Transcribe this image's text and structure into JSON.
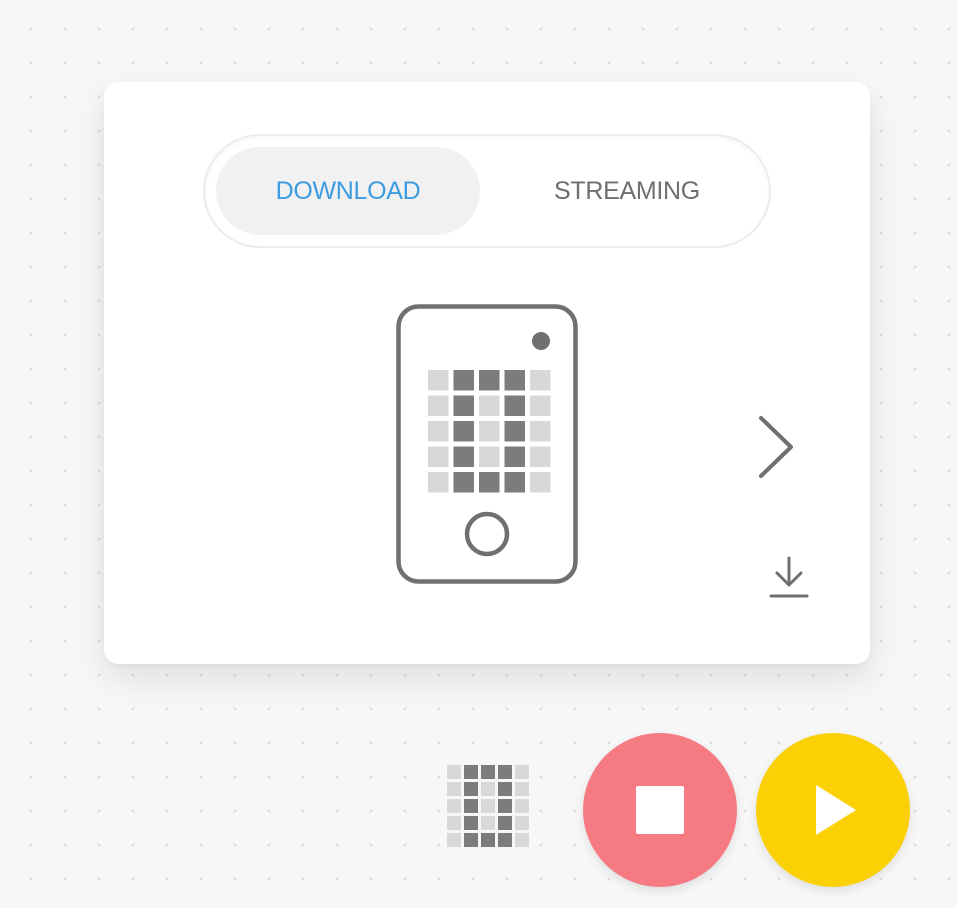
{
  "tabs": {
    "download_label": "DOWNLOAD",
    "streaming_label": "STREAMING",
    "active": "download"
  },
  "icons": {
    "device": "phone-led-matrix-icon",
    "next": "chevron-right-icon",
    "download": "download-icon",
    "preview": "led-matrix-icon",
    "stop": "stop-icon",
    "play": "play-icon"
  },
  "led_pattern": [
    [
      0,
      1,
      1,
      1,
      0
    ],
    [
      0,
      1,
      0,
      1,
      0
    ],
    [
      0,
      1,
      0,
      1,
      0
    ],
    [
      0,
      1,
      0,
      1,
      0
    ],
    [
      0,
      1,
      1,
      1,
      0
    ]
  ],
  "colors": {
    "active_tab_text": "#3d9be0",
    "inactive_tab_text": "#6f6f6f",
    "led_on": "#7c7c7c",
    "led_off": "#d8d8d8",
    "stop_button": "#f67a82",
    "play_button": "#fbd005"
  }
}
